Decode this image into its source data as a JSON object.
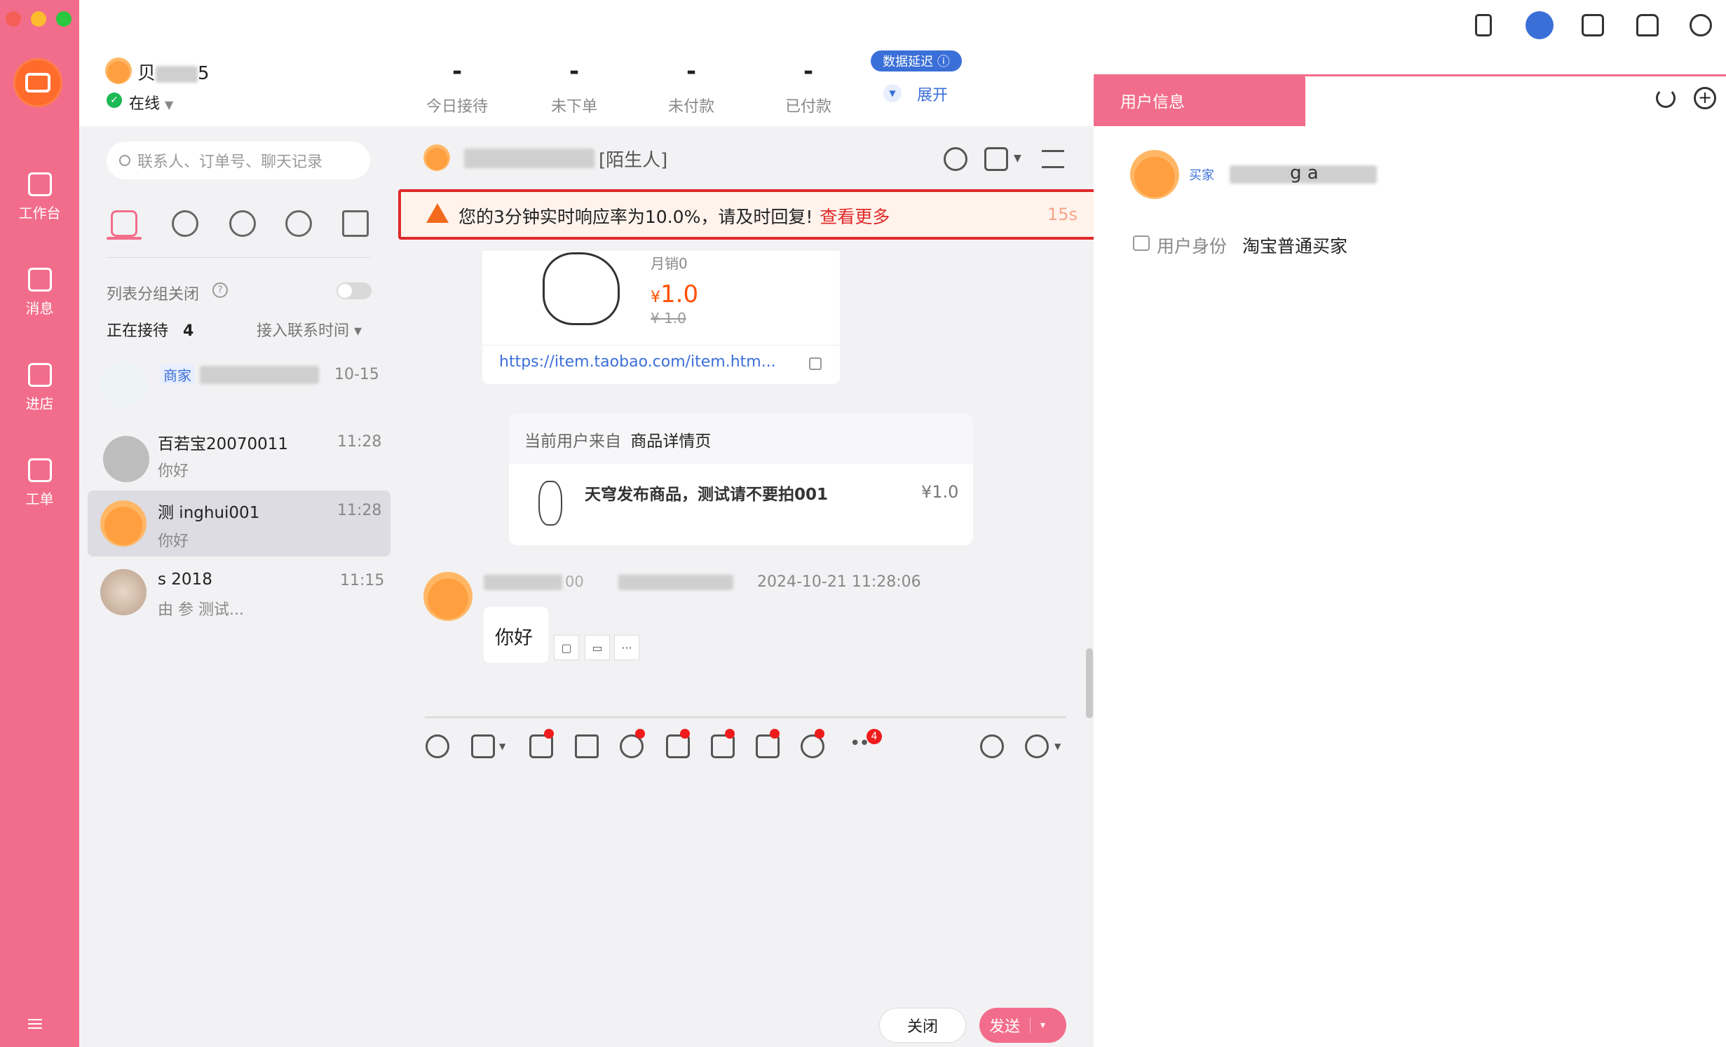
{
  "rail": {
    "items": [
      {
        "label": "工作台",
        "icon": "workbench-icon"
      },
      {
        "label": "消息",
        "icon": "message-icon"
      },
      {
        "label": "进店",
        "icon": "store-icon"
      },
      {
        "label": "工单",
        "icon": "ticket-icon"
      }
    ]
  },
  "header": {
    "username_suffix": "5",
    "username_prefix": "贝",
    "status": "在线",
    "stats": [
      {
        "value": "-",
        "label": "今日接待"
      },
      {
        "value": "-",
        "label": "未下单"
      },
      {
        "value": "-",
        "label": "未付款"
      },
      {
        "value": "-",
        "label": "已付款"
      }
    ],
    "delay_badge": "数据延迟 ⓘ",
    "expand": "展开"
  },
  "contacts": {
    "search_placeholder": "联系人、订单号、聊天记录",
    "group_close_label": "列表分组关闭",
    "receiving_label": "正在接待",
    "receiving_count": "4",
    "sort_label": "接入联系时间 ▾",
    "list": [
      {
        "tag": "商家",
        "name": "",
        "time": "10-15",
        "msg": ""
      },
      {
        "name": "百若宝20070011",
        "time": "11:28",
        "msg": "你好"
      },
      {
        "name": "测 inghui001",
        "time": "11:28",
        "msg": "你好"
      },
      {
        "name": "s 2018",
        "time": "11:15",
        "msg": "由 参 测试..."
      }
    ]
  },
  "chat": {
    "peer_suffix": "[陌生人]",
    "alert_text": "您的3分钟实时响应率为10.0%，请及时回复!",
    "alert_link": "查看更多",
    "alert_timer": "15s",
    "product_card": {
      "monthly_sales": "月销0",
      "price_symbol": "¥",
      "price": "1.0",
      "original_price": "¥ 1.0",
      "url": "https://item.taobao.com/item.htm..."
    },
    "source_card": {
      "source_prefix": "当前用户来自",
      "source_page": "商品详情页",
      "product_title": "天穹发布商品，测试请不要拍001",
      "product_price": "¥1.0"
    },
    "message": {
      "sender_id": "00",
      "timestamp": "2024-10-21 11:28:06",
      "text": "你好"
    },
    "toolbar_badge": "4",
    "close_button": "关闭",
    "send_button": "发送",
    "send_caret": "▾"
  },
  "right_panel": {
    "tab_label": "用户信息",
    "buyer_tag": "买家",
    "buyer_name": "g a",
    "identity_label": "用户身份",
    "identity_value": "淘宝普通买家"
  },
  "colors": {
    "brand_pink": "#f26d8b",
    "alert_red": "#e02929",
    "price_orange": "#ff5000",
    "link_blue": "#3b6fd8"
  }
}
